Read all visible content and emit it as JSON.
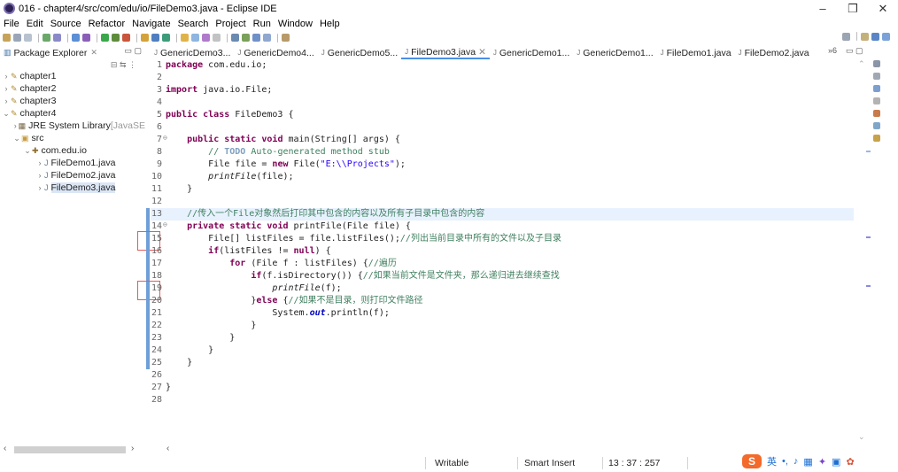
{
  "window": {
    "title": "016 - chapter4/src/com/edu/io/FileDemo3.java - Eclipse IDE",
    "minimize": "–",
    "maximize": "❐",
    "close": "✕"
  },
  "menu": [
    "File",
    "Edit",
    "Source",
    "Refactor",
    "Navigate",
    "Search",
    "Project",
    "Run",
    "Window",
    "Help"
  ],
  "explorer": {
    "tab_label": "Package Explorer",
    "nodes": [
      {
        "label": "chapter1",
        "twisty": "›",
        "icon": "✎"
      },
      {
        "label": "chapter2",
        "twisty": "›",
        "icon": "✎"
      },
      {
        "label": "chapter3",
        "twisty": "›",
        "icon": "✎"
      },
      {
        "label": "chapter4",
        "twisty": "⌄",
        "icon": "✎"
      },
      {
        "label": "JRE System Library",
        "suffix": " [JavaSE",
        "twisty": "›",
        "icon": "▦"
      },
      {
        "label": "src",
        "twisty": "⌄",
        "icon": "▣"
      },
      {
        "label": "com.edu.io",
        "twisty": "⌄",
        "icon": "✚"
      },
      {
        "label": "FileDemo1.java",
        "twisty": "›",
        "icon": "J"
      },
      {
        "label": "FileDemo2.java",
        "twisty": "›",
        "icon": "J"
      },
      {
        "label": "FileDemo3.java",
        "twisty": "›",
        "icon": "J"
      }
    ]
  },
  "tabs": [
    {
      "label": "GenericDemo3..."
    },
    {
      "label": "GenericDemo4..."
    },
    {
      "label": "GenericDemo5..."
    },
    {
      "label": "FileDemo3.java",
      "active": true
    },
    {
      "label": "GenericDemo1..."
    },
    {
      "label": "GenericDemo1..."
    },
    {
      "label": "FileDemo1.java"
    },
    {
      "label": "FileDemo2.java"
    }
  ],
  "tab_overflow": "»6",
  "code_lines": [
    {
      "n": "1",
      "html": "<span class=\"kw\">package</span> com.edu.io;"
    },
    {
      "n": "2",
      "html": ""
    },
    {
      "n": "3",
      "html": "<span class=\"kw\">import</span> java.io.File;"
    },
    {
      "n": "4",
      "html": ""
    },
    {
      "n": "5",
      "html": "<span class=\"kw\">public class</span> FileDemo3 {"
    },
    {
      "n": "6",
      "html": ""
    },
    {
      "n": "7",
      "fold": "⊖",
      "html": "    <span class=\"kw\">public static void</span> main(String[] args) {"
    },
    {
      "n": "8",
      "html": "        <span class=\"cm\">// <span class=\"todo\">TODO</span> Auto-generated method stub</span>"
    },
    {
      "n": "9",
      "html": "        File file = <span class=\"kw\">new</span> File(<span class=\"st\">\"E:\\\\Projects\"</span>);"
    },
    {
      "n": "10",
      "html": "        <span class=\"it\">printFile</span>(file);"
    },
    {
      "n": "11",
      "html": "    }"
    },
    {
      "n": "12",
      "html": ""
    },
    {
      "n": "13",
      "mark": true,
      "hl": true,
      "html": "    <span class=\"cm\">//传入一个File对象然后打印其中包含的内容以及所有子目录中包含的内容</span>"
    },
    {
      "n": "14",
      "mark": true,
      "fold": "⊖",
      "html": "    <span class=\"kw\">private static void</span> printFile(File file) {"
    },
    {
      "n": "15",
      "mark": true,
      "box": true,
      "html": "        File[] listFiles = file.listFiles();<span class=\"cm\">//列出当前目录中所有的文件以及子目录</span>"
    },
    {
      "n": "16",
      "mark": true,
      "html": "        <span class=\"kw\">if</span>(listFiles != <span class=\"kw\">null</span>) {"
    },
    {
      "n": "17",
      "mark": true,
      "html": "            <span class=\"kw\">for</span> (File f : listFiles) {<span class=\"cm\">//遍历</span>"
    },
    {
      "n": "18",
      "mark": true,
      "html": "                <span class=\"kw\">if</span>(f.isDirectory()) {<span class=\"cm\">//如果当前文件是文件夹，那么递归进去继续查找</span>"
    },
    {
      "n": "19",
      "mark": true,
      "box": true,
      "html": "                    <span class=\"it\">printFile</span>(f);"
    },
    {
      "n": "20",
      "mark": true,
      "html": "                }<span class=\"kw\">else</span> {<span class=\"cm\">//如果不是目录，则打印文件路径</span>"
    },
    {
      "n": "21",
      "mark": true,
      "html": "                    System.<span class=\"fi\">out</span>.println(f);"
    },
    {
      "n": "22",
      "mark": true,
      "html": "                }"
    },
    {
      "n": "23",
      "mark": true,
      "html": "            }"
    },
    {
      "n": "24",
      "mark": true,
      "html": "        }"
    },
    {
      "n": "25",
      "mark": true,
      "html": "    }"
    },
    {
      "n": "26",
      "html": ""
    },
    {
      "n": "27",
      "html": "}"
    },
    {
      "n": "28",
      "html": ""
    }
  ],
  "status": {
    "mode": "Writable",
    "insert": "Smart Insert",
    "position": "13 : 37 : 257"
  },
  "tray": {
    "ime_logo": "S",
    "ime_lang": "英"
  },
  "colors": {
    "keyword": "#7f0055",
    "comment": "#3f7f5f",
    "string": "#2a00ff",
    "accent": "#4a8fe8",
    "annotation_box": "#e35b5b"
  }
}
